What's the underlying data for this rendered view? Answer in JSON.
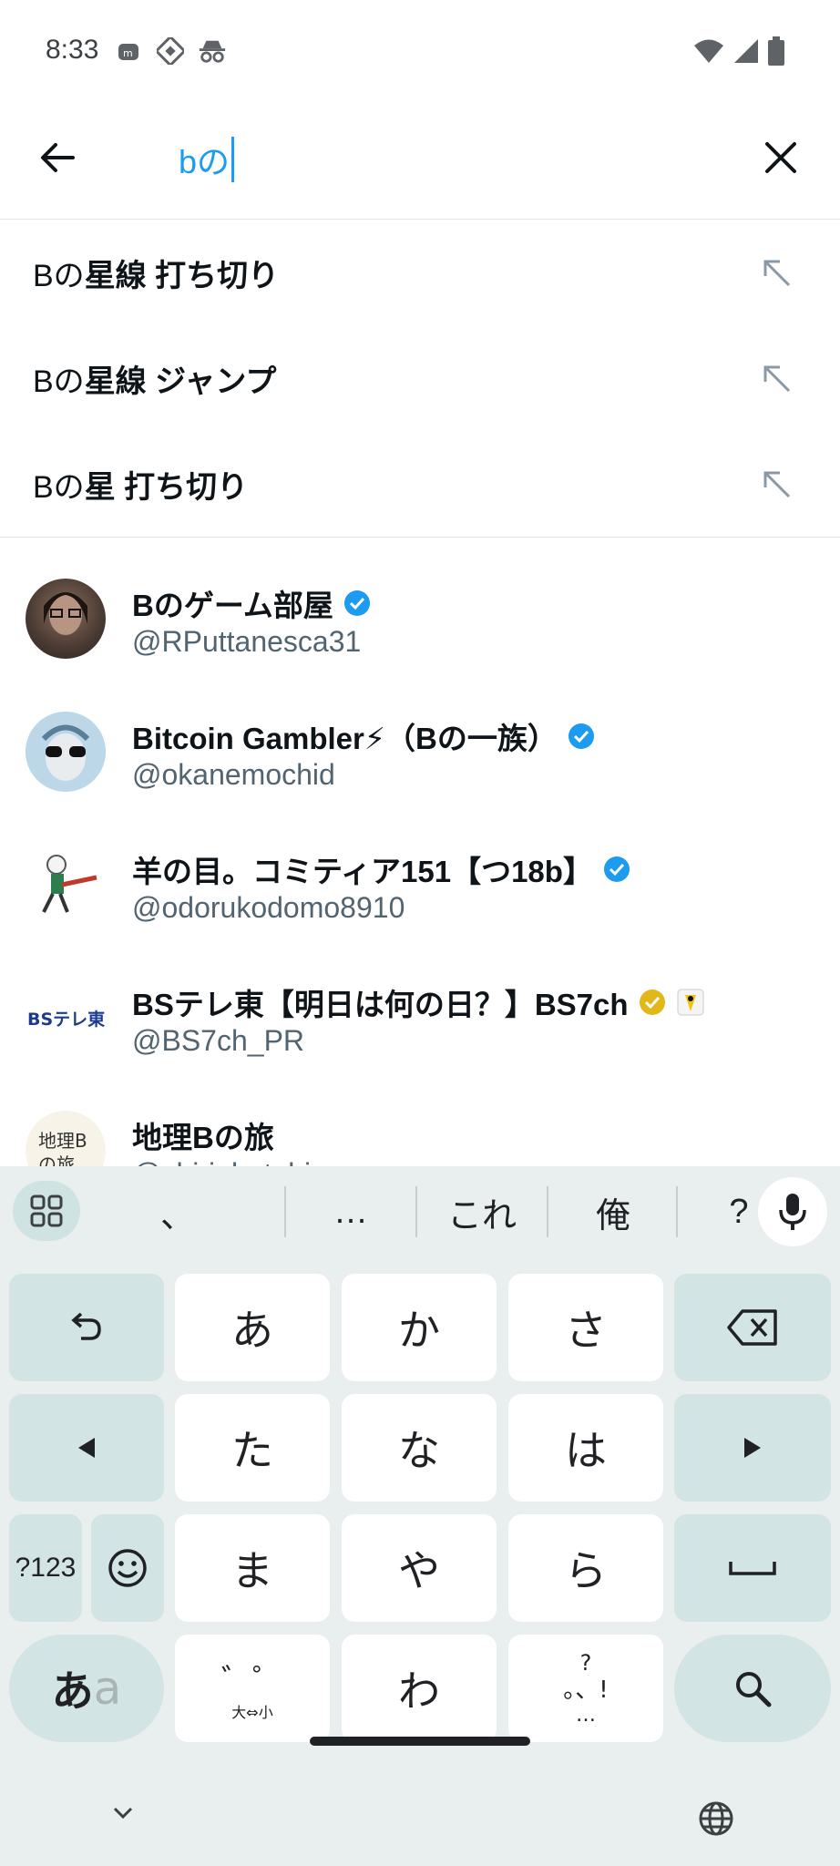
{
  "status_bar": {
    "time": "8:33",
    "left_icons": [
      "notification-icon",
      "photo-app-icon",
      "incognito-icon"
    ],
    "right_icons": [
      "wifi-icon",
      "cell-signal-icon",
      "battery-icon"
    ]
  },
  "search": {
    "query": "bの",
    "back_icon": "arrow-left-icon",
    "clear_icon": "close-icon"
  },
  "suggestions": [
    {
      "prefix": "Bの",
      "rest": "星線 打ち切り"
    },
    {
      "prefix": "Bの",
      "rest": "星線 ジャンプ"
    },
    {
      "prefix": "Bの",
      "rest": "星 打ち切り"
    }
  ],
  "users": [
    {
      "name": "Bのゲーム部屋",
      "handle": "@RPuttanesca31",
      "badge": "blue"
    },
    {
      "name": "Bitcoin Gambler⚡（Bの一族）",
      "handle": "@okanemochid",
      "badge": "blue"
    },
    {
      "name": "羊の目。コミティア151【つ18b】",
      "handle": "@odorukodomo8910",
      "badge": "blue"
    },
    {
      "name": "BSテレ東【明日は何の日？】BS7ch",
      "handle": "@BS7ch_PR",
      "badge": "gold"
    },
    {
      "name": "地理Bの旅",
      "handle": "@chiri_b_tabi",
      "badge": "none"
    }
  ],
  "keyboard": {
    "candidates": [
      "、",
      "…",
      "これ",
      "俺",
      "?"
    ],
    "rows": [
      [
        "あ",
        "か",
        "さ"
      ],
      [
        "た",
        "な",
        "は"
      ],
      [
        "ま",
        "や",
        "ら"
      ],
      [
        "",
        "わ",
        ""
      ]
    ],
    "sym_label": "?123",
    "mode_label_a": "あ",
    "mode_label_b": "a",
    "dakuten_top": "゛゜",
    "dakuten_bottom": "大⇔小",
    "punct_top": "?",
    "punct_mid": "。、!",
    "punct_bottom": "…"
  },
  "colors": {
    "accent": "#1d9bf0",
    "verified_blue": "#1d9bf0",
    "verified_gold": "#e2b719",
    "key_dark": "#d2e4e3",
    "keyboard_bg": "#e9eeee"
  }
}
